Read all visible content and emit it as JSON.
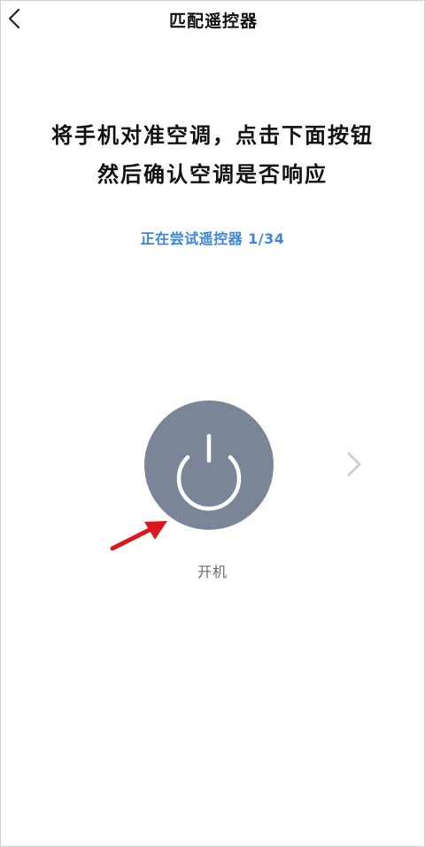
{
  "header": {
    "title": "匹配遥控器",
    "back_icon": "chevron-left-icon"
  },
  "instructions": {
    "line1": "将手机对准空调，点击下面按钮",
    "line2": "然后确认空调是否响应"
  },
  "progress": {
    "text": "正在尝试遥控器 1/34",
    "current": 1,
    "total": 34
  },
  "power": {
    "label": "开机",
    "icon": "power-icon"
  },
  "next": {
    "icon": "chevron-right-icon"
  },
  "colors": {
    "accent": "#3e86d9",
    "power_button": "#7a8698",
    "annotation_arrow": "#e0161f"
  }
}
